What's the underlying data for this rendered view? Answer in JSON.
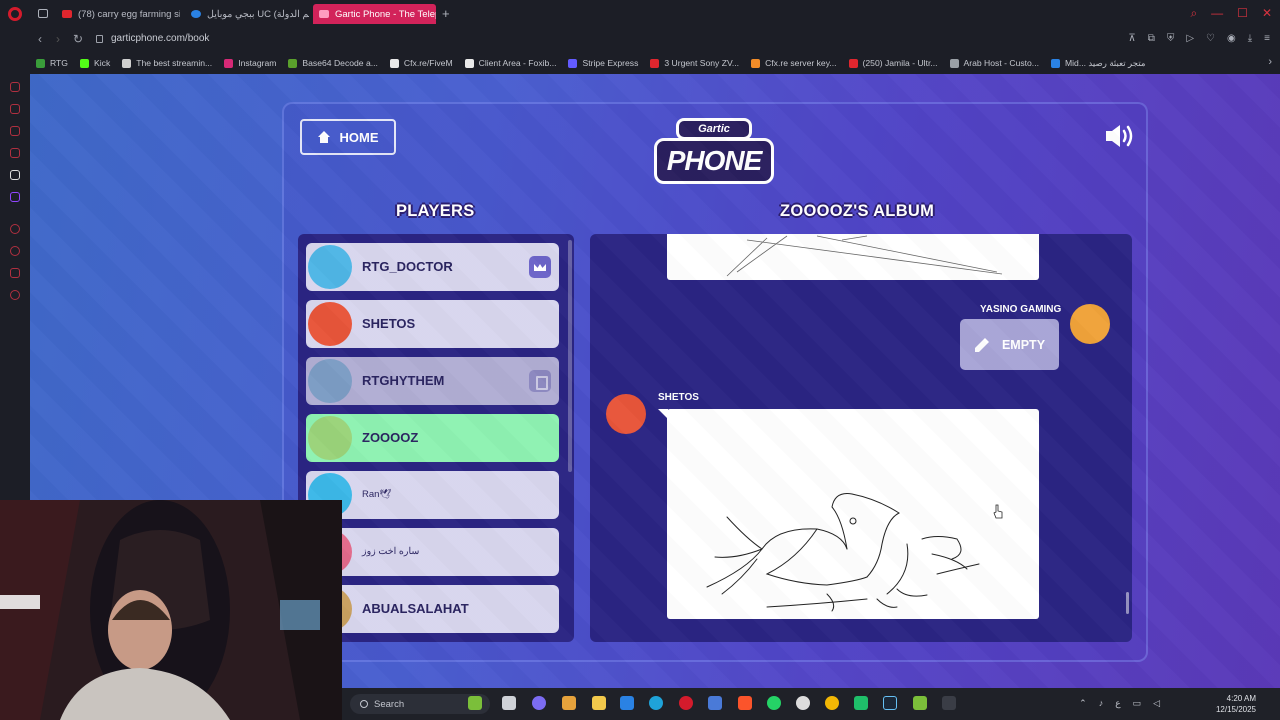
{
  "browser": {
    "tabs": [
      {
        "label": "(78) carry egg farming si",
        "color": "#e0262e"
      },
      {
        "label": "ببجي موبايل UC (اسم الدولة",
        "color": "#2a82e4"
      },
      {
        "label": "Gartic Phone - The Teleph",
        "color": "#ff6fa0"
      }
    ],
    "url": "garticphone.com/book",
    "bookmarks": [
      {
        "label": "RTG",
        "color": "#3a9d3a"
      },
      {
        "label": "Kick",
        "color": "#53fc18"
      },
      {
        "label": "The best streamin...",
        "color": "#d0d0d0"
      },
      {
        "label": "Instagram",
        "color": "#d62976"
      },
      {
        "label": "Base64 Decode a...",
        "color": "#5aa02c"
      },
      {
        "label": "Cfx.re/FiveM",
        "color": "#e9e9e9"
      },
      {
        "label": "Client Area - Foxib...",
        "color": "#e9e9e9"
      },
      {
        "label": "Stripe Express",
        "color": "#635bff"
      },
      {
        "label": "3 Urgent Sony ZV...",
        "color": "#e0262e"
      },
      {
        "label": "Cfx.re server key...",
        "color": "#f28c28"
      },
      {
        "label": "(250) Jamila - Ultr...",
        "color": "#e0262e"
      },
      {
        "label": "Arab Host - Custo...",
        "color": "#9aa0a6"
      },
      {
        "label": "Mid... متجر تعبئة رصيد",
        "color": "#2a82e4"
      }
    ]
  },
  "game": {
    "home_label": "HOME",
    "logo_top": "Gartic",
    "logo_main": "PHONE",
    "players_title": "PLAYERS",
    "album_title": "ZOOOOZ'S ALBUM",
    "players": [
      {
        "name": "RTG_DOCTOR",
        "badge": "crown",
        "avatar": "#4fb6e6",
        "state": "normal"
      },
      {
        "name": "SHETOS",
        "badge": "",
        "avatar": "#e8553a",
        "state": "normal"
      },
      {
        "name": "RTGHYTHEM",
        "badge": "exit",
        "avatar": "#7c9cc4",
        "state": "dim"
      },
      {
        "name": "ZOOOOZ",
        "badge": "",
        "avatar": "#9ad37a",
        "state": "current"
      },
      {
        "name": "Ran🕊",
        "badge": "",
        "avatar": "#3cb8e8",
        "state": "normal"
      },
      {
        "name": "ساره اخت زوز",
        "badge": "",
        "avatar": "#e26a8a",
        "state": "normal"
      },
      {
        "name": "ABUALSALAHAT",
        "badge": "",
        "avatar": "#c8a060",
        "state": "normal"
      }
    ],
    "album": {
      "entry1_author": "YASINO GAMING",
      "entry1_action": "EMPTY",
      "entry2_author": "SHETOS"
    }
  },
  "taskbar": {
    "search_placeholder": "Search",
    "time": "4:20 AM",
    "date": "12/15/2025"
  }
}
